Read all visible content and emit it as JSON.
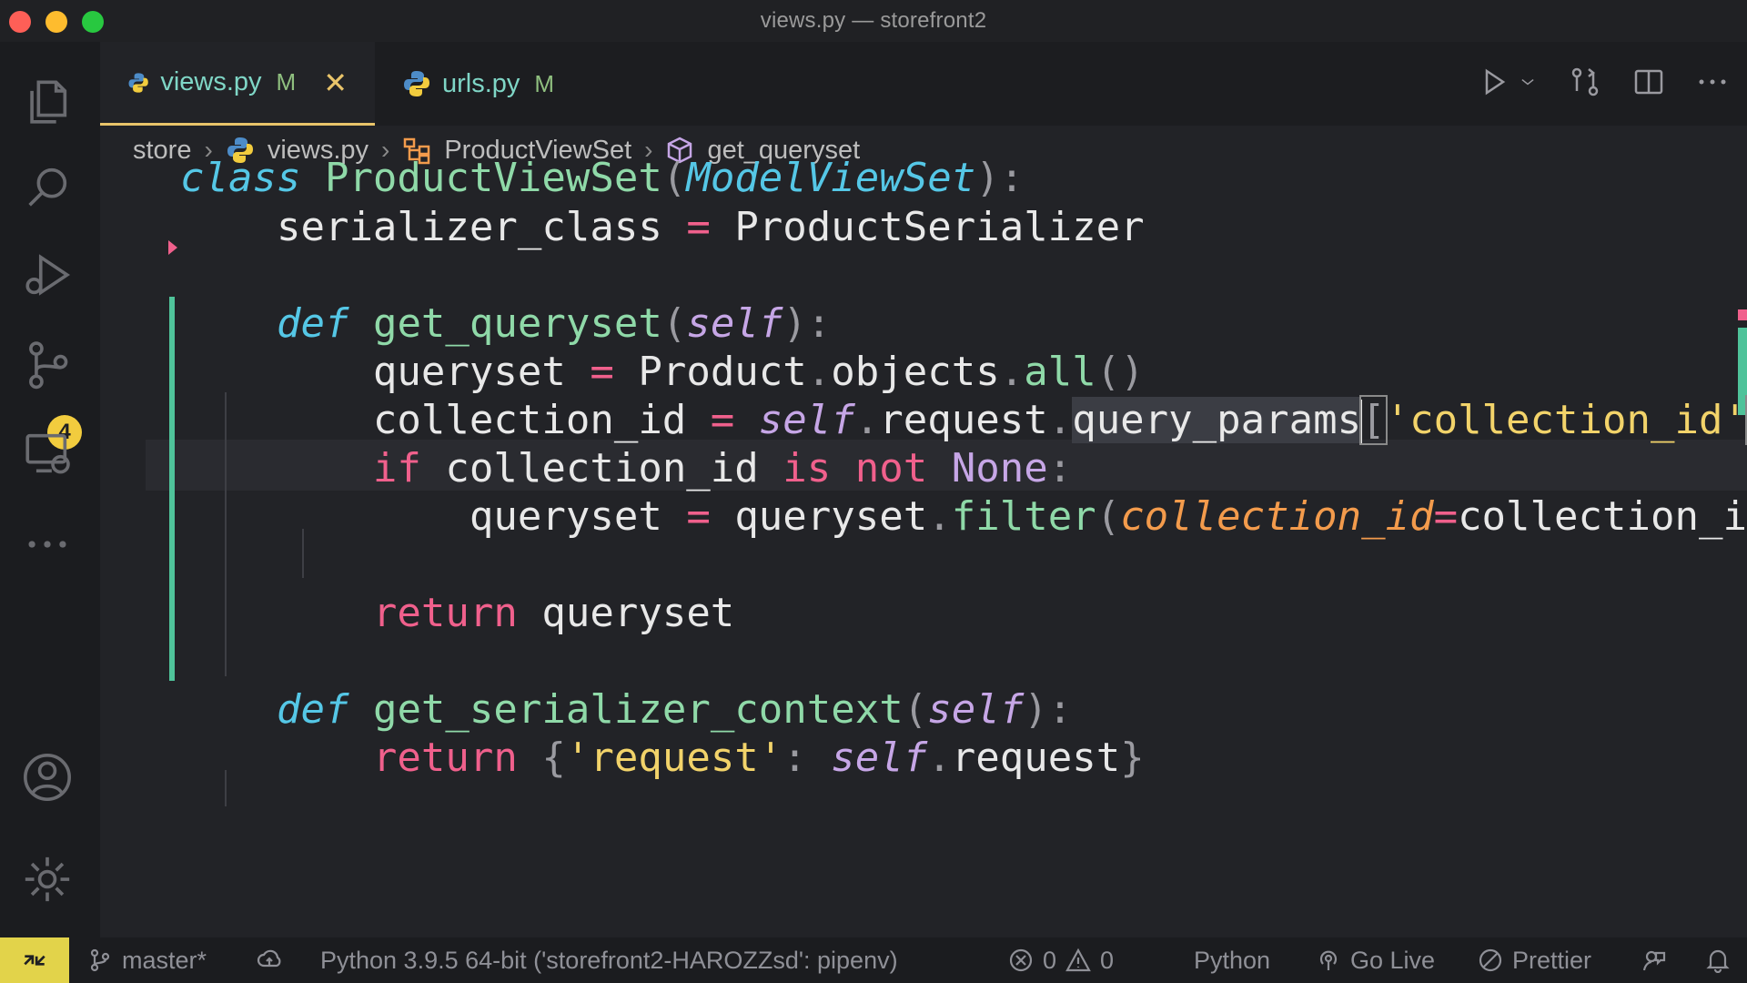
{
  "window": {
    "title": "views.py — storefront2"
  },
  "activity_bar": {
    "source_control_badge": "4"
  },
  "tabs": [
    {
      "label": "views.py",
      "status": "M",
      "active": true
    },
    {
      "label": "urls.py",
      "status": "M",
      "active": false
    }
  ],
  "breadcrumb": {
    "folder": "store",
    "file": "views.py",
    "class": "ProductViewSet",
    "method": "get_queryset"
  },
  "code": {
    "l1": {
      "kw": "class",
      "name": "ProductViewSet",
      "base": "ModelViewSet"
    },
    "l2": {
      "var": "serializer_class",
      "op": "=",
      "val": "ProductSerializer"
    },
    "l4": {
      "kw": "def",
      "name": "get_queryset",
      "self": "self"
    },
    "l5": {
      "var": "queryset",
      "op": "=",
      "obj": "Product",
      "attr": "objects",
      "call": "all"
    },
    "l6": {
      "var": "collection_id",
      "op": "=",
      "self": "self",
      "attr": "request",
      "attr2": "query_params",
      "key": "'collection_id'"
    },
    "l7": {
      "kw": "if",
      "var": "collection_id",
      "is": "is",
      "not": "not",
      "none": "None"
    },
    "l8": {
      "var": "queryset",
      "op": "=",
      "obj": "queryset",
      "call": "filter",
      "kwarg": "collection_id",
      "val": "collection_id"
    },
    "l10": {
      "kw": "return",
      "val": "queryset"
    },
    "l12": {
      "kw": "def",
      "name": "get_serializer_context",
      "self": "self"
    },
    "l13": {
      "kw": "return",
      "key": "'request'",
      "self": "self",
      "attr": "request"
    }
  },
  "status_bar": {
    "branch": "master*",
    "interpreter": "Python 3.9.5 64-bit ('storefront2-HAROZZsd': pipenv)",
    "errors": "0",
    "warnings": "0",
    "language": "Python",
    "go_live": "Go Live",
    "prettier": "Prettier"
  },
  "colors": {
    "accent_tab": "#e9c46a",
    "git_added": "#4fc39a",
    "badge": "#f2cc3e",
    "remote": "#e2d34a"
  }
}
